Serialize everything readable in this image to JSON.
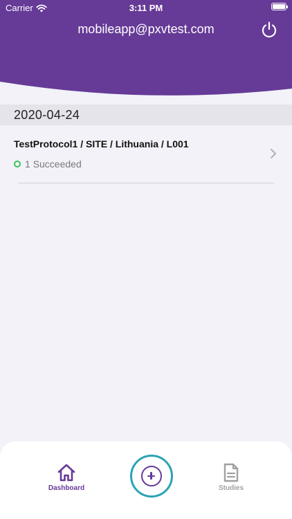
{
  "status_bar": {
    "carrier": "Carrier",
    "time": "3:11 PM"
  },
  "header": {
    "title": "mobileapp@pxvtest.com",
    "power_icon": "power-icon"
  },
  "date_section": {
    "date": "2020-04-24"
  },
  "items": [
    {
      "title": "TestProtocol1 / SITE / Lithuania / L001",
      "status": "1 Succeeded",
      "status_color": "#3cc35a"
    }
  ],
  "tabbar": {
    "dashboard_label": "Dashboard",
    "studies_label": "Studies",
    "add_icon": "add-circle-icon"
  },
  "colors": {
    "brand": "#663a97",
    "accent": "#2aa3b4",
    "background": "#f2f2f8"
  }
}
